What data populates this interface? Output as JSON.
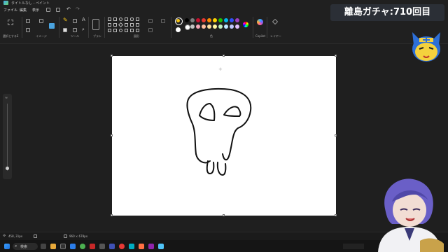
{
  "window": {
    "title": "タイトルなし - ペイント"
  },
  "menu": [
    "ファイル",
    "編集",
    "表示"
  ],
  "ribbon": {
    "groups": [
      "選択とするE",
      "イメージ",
      "ツール",
      "ブラシ",
      "図形",
      "色",
      "Copilot",
      "レイヤー"
    ],
    "colors": [
      "#000000",
      "#7f7f7f",
      "#c8102e",
      "#e8392f",
      "#ff8c00",
      "#ffd200",
      "#20c000",
      "#00b7eb",
      "#3050f8",
      "#a040c0",
      "#ffffff",
      "#c3c3c3",
      "#f7a8b8",
      "#ffc0a0",
      "#ffe0a0",
      "#fff7a0",
      "#c0f0c0",
      "#c0e8ff",
      "#c0c8ff",
      "#e0c0ff"
    ],
    "selected_color": "#f5c518"
  },
  "status": {
    "cursor": "458, 31px",
    "size": "960 × 678px"
  },
  "overlay": {
    "stream_title": "離島ガチャ:710回目"
  },
  "taskbar": {
    "search": "検索"
  }
}
